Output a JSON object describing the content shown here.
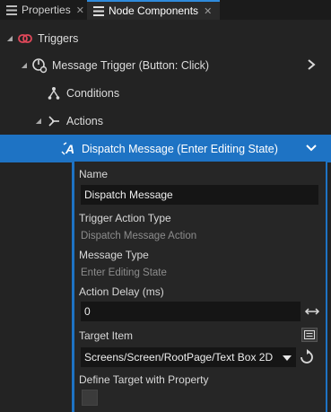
{
  "tabs": [
    {
      "label": "Properties",
      "icon": "list-icon",
      "closable": true
    },
    {
      "label": "Node Components",
      "icon": "list-icon",
      "closable": true,
      "active": true
    }
  ],
  "tree": {
    "triggers": {
      "label": "Triggers",
      "icon": "trigger-link-icon"
    },
    "message_trigger": {
      "label": "Message Trigger (Button: Click)",
      "icon": "message-trigger-icon"
    },
    "conditions": {
      "label": "Conditions",
      "icon": "conditions-icon"
    },
    "actions": {
      "label": "Actions",
      "icon": "actions-icon"
    },
    "dispatch": {
      "label": "Dispatch Message (Enter Editing State)",
      "icon": "dispatch-message-icon"
    }
  },
  "details": {
    "name_label": "Name",
    "name_value": "Dispatch Message",
    "trigger_action_type_label": "Trigger Action Type",
    "trigger_action_type_value": "Dispatch Message Action",
    "message_type_label": "Message Type",
    "message_type_value": "Enter Editing State",
    "action_delay_label": "Action Delay (ms)",
    "action_delay_value": "0",
    "target_item_label": "Target Item",
    "target_item_value": "Screens/Screen/RootPage/Text Box 2D",
    "define_target_label": "Define Target with Property",
    "define_target_checked": false
  },
  "colors": {
    "selection": "#1e73c4",
    "background": "#232323",
    "field": "#151515",
    "trigger_icon": "#e0485a"
  }
}
